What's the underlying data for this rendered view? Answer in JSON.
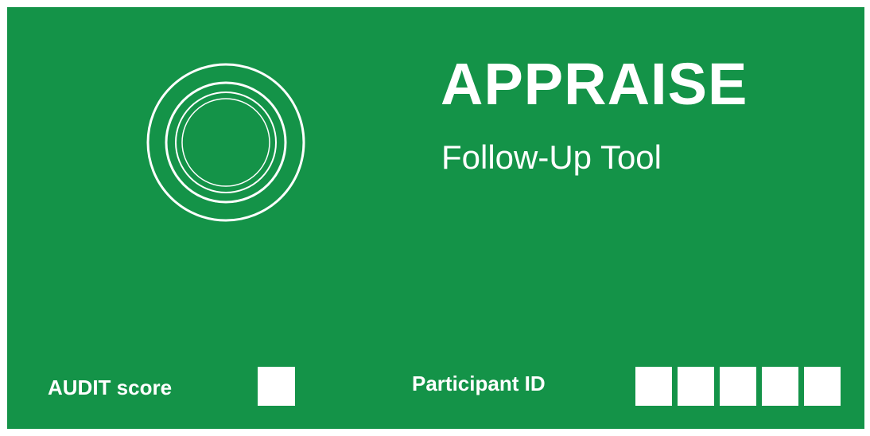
{
  "header": {
    "title": "APPRAISE",
    "subtitle": "Follow-Up Tool"
  },
  "logo": {
    "icon": "concentric-circles-icon"
  },
  "form": {
    "audit_label": "AUDIT score",
    "participant_label": "Participant ID",
    "participant_box_count": 5
  },
  "colors": {
    "background": "#149348",
    "foreground": "#ffffff"
  }
}
